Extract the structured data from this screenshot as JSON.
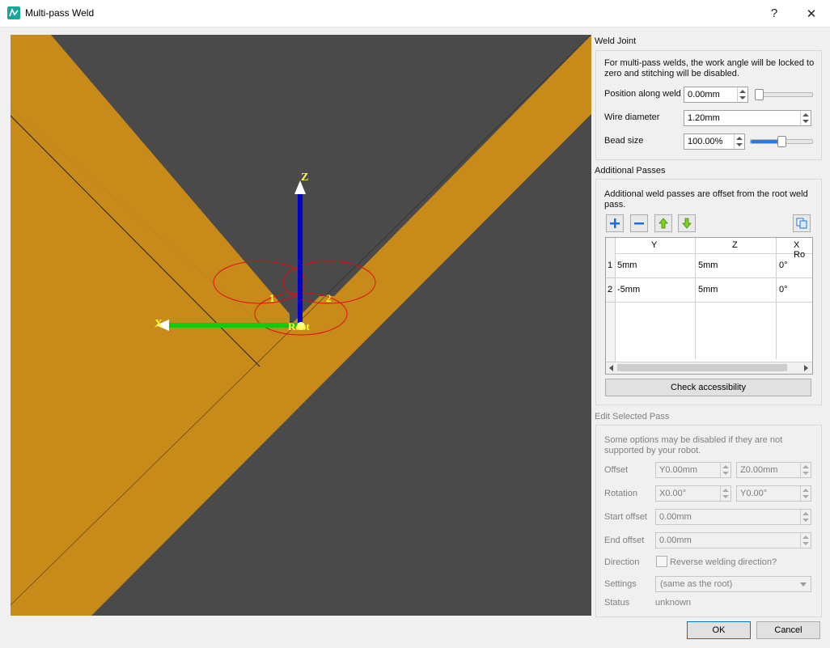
{
  "window": {
    "title": "Multi-pass Weld",
    "help": "?",
    "close": "✕"
  },
  "viewport": {
    "axis_z": "Z",
    "axis_x": "X",
    "root_label": "Root",
    "pass1_label": "1",
    "pass2_label": "2"
  },
  "weld_joint": {
    "title": "Weld Joint",
    "info": "For multi-pass welds, the work angle will be locked to zero and stitching will be disabled.",
    "position_label": "Position along weld",
    "position_value": "0.00mm",
    "position_slider": 0,
    "wire_label": "Wire diameter",
    "wire_value": "1.20mm",
    "bead_label": "Bead size",
    "bead_value": "100.00%",
    "bead_slider": 0.5
  },
  "additional_passes": {
    "title": "Additional Passes",
    "info": "Additional weld passes are offset from the root weld pass.",
    "columns": [
      "Y",
      "Z",
      "X Ro"
    ],
    "rows": [
      {
        "num": "1",
        "y": "5mm",
        "z": "5mm",
        "x": "0°"
      },
      {
        "num": "2",
        "y": "-5mm",
        "z": "5mm",
        "x": "0°"
      }
    ],
    "check_button": "Check accessibility"
  },
  "edit_pass": {
    "title": "Edit Selected Pass",
    "info": "Some options may be disabled if they are not supported by your robot.",
    "offset_label": "Offset",
    "offset_y": "Y0.00mm",
    "offset_z": "Z0.00mm",
    "rotation_label": "Rotation",
    "rotation_x": "X0.00°",
    "rotation_y": "Y0.00°",
    "start_label": "Start offset",
    "start_value": "0.00mm",
    "end_label": "End offset",
    "end_value": "0.00mm",
    "direction_label": "Direction",
    "direction_checkbox": "Reverse welding direction?",
    "settings_label": "Settings",
    "settings_value": "(same as the root)",
    "status_label": "Status",
    "status_value": "unknown"
  },
  "footer": {
    "ok": "OK",
    "cancel": "Cancel"
  },
  "colors": {
    "plate": "#c88b1a",
    "background": "#4a4a4a",
    "circle": "#e01010",
    "z_axis": "#0000cc",
    "x_axis": "#10cc10",
    "label": "#ffff33"
  }
}
